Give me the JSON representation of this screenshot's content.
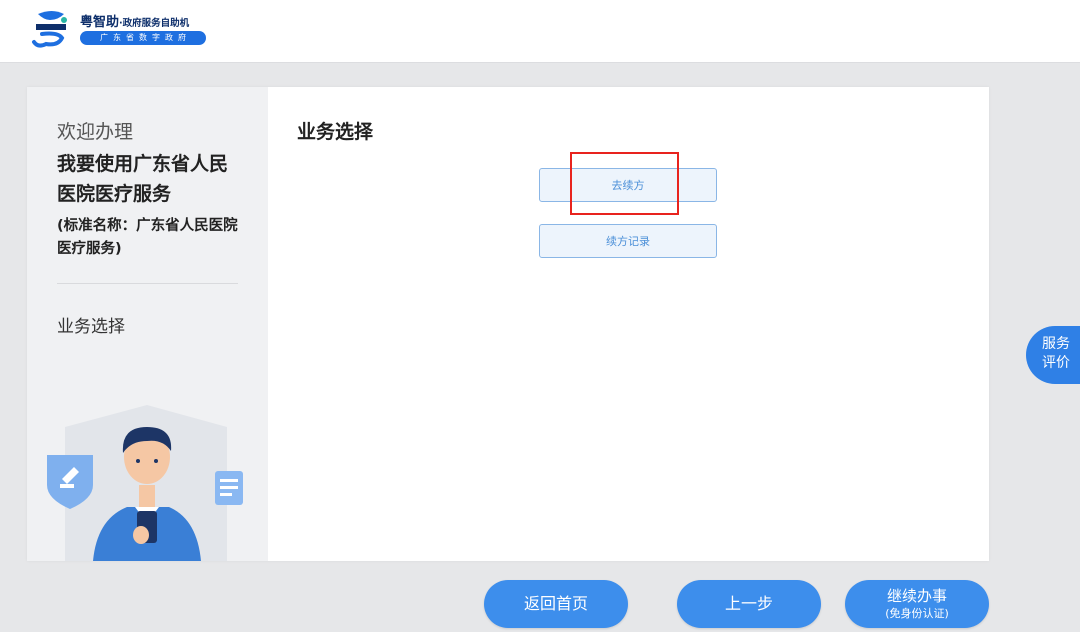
{
  "header": {
    "brand_title": "粤智助",
    "brand_subtitle": "·政府服务自助机",
    "brand_org": "广东省数字政府"
  },
  "sidebar": {
    "welcome": "欢迎办理",
    "service_name": "我要使用广东省人民医院医疗服务",
    "standard_name": "(标准名称：广东省人民医院医疗服务)",
    "current_step": "业务选择"
  },
  "main": {
    "title": "业务选择",
    "options": [
      "去续方",
      "续方记录"
    ]
  },
  "rating_tab": {
    "line1": "服务",
    "line2": "评价"
  },
  "footer": {
    "home": "返回首页",
    "prev": "上一步",
    "continue_line1": "继续办事",
    "continue_line2": "(免身份认证)"
  },
  "colors": {
    "primary": "#3d8eec",
    "brand_pill": "#1e6fe0",
    "option_border": "#8ab6e6",
    "highlight": "#e8231e"
  }
}
